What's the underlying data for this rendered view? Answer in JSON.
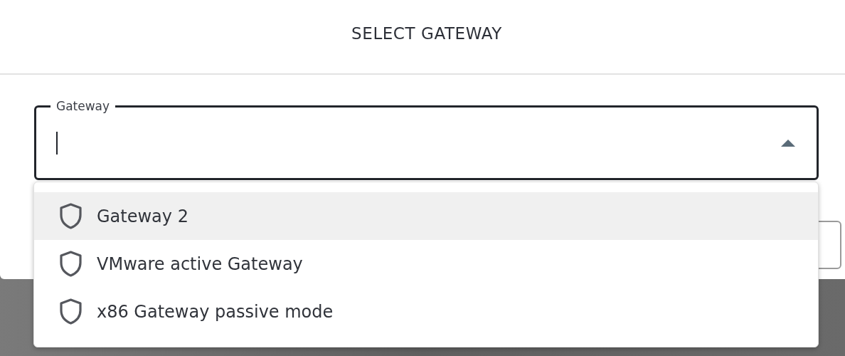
{
  "dialog": {
    "title": "SELECT GATEWAY"
  },
  "gateway_field": {
    "label": "Gateway",
    "focused": true,
    "expanded": true
  },
  "options": [
    {
      "label": "Gateway 2",
      "selected": true
    },
    {
      "label": "VMware active Gateway",
      "selected": false
    },
    {
      "label": "x86 Gateway passive mode",
      "selected": false
    }
  ]
}
